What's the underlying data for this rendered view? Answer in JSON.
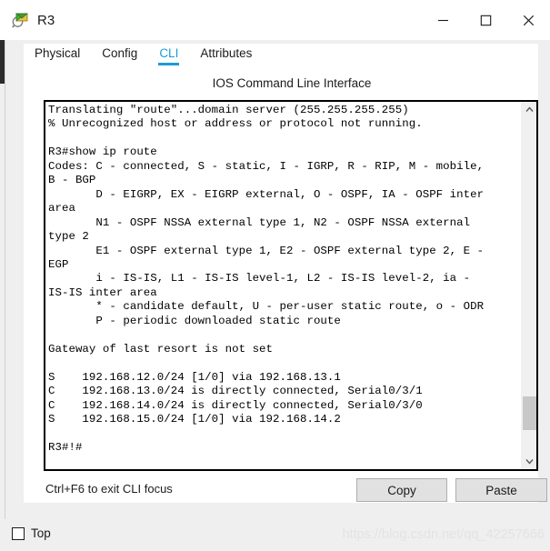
{
  "window": {
    "title": "R3",
    "icon": "packet-tracer-router-icon",
    "controls": {
      "minimize": "minimize-icon",
      "maximize": "maximize-icon",
      "close": "close-icon"
    }
  },
  "tabs": [
    {
      "label": "Physical",
      "active": false
    },
    {
      "label": "Config",
      "active": false
    },
    {
      "label": "CLI",
      "active": true
    },
    {
      "label": "Attributes",
      "active": false
    }
  ],
  "panel": {
    "title": "IOS Command Line Interface"
  },
  "terminal": {
    "lines": [
      "Translating \"route\"...domain server (255.255.255.255)",
      "% Unrecognized host or address or protocol not running.",
      "",
      "R3#show ip route",
      "Codes: C - connected, S - static, I - IGRP, R - RIP, M - mobile,",
      "B - BGP",
      "       D - EIGRP, EX - EIGRP external, O - OSPF, IA - OSPF inter",
      "area",
      "       N1 - OSPF NSSA external type 1, N2 - OSPF NSSA external",
      "type 2",
      "       E1 - OSPF external type 1, E2 - OSPF external type 2, E -",
      "EGP",
      "       i - IS-IS, L1 - IS-IS level-1, L2 - IS-IS level-2, ia -",
      "IS-IS inter area",
      "       * - candidate default, U - per-user static route, o - ODR",
      "       P - periodic downloaded static route",
      "",
      "Gateway of last resort is not set",
      "",
      "S    192.168.12.0/24 [1/0] via 192.168.13.1",
      "C    192.168.13.0/24 is directly connected, Serial0/3/1",
      "C    192.168.14.0/24 is directly connected, Serial0/3/0",
      "S    192.168.15.0/24 [1/0] via 192.168.14.2",
      "",
      "R3#!#"
    ],
    "scrollbar": {
      "up_arrow": "chevron-up-icon",
      "down_arrow": "chevron-down-icon",
      "thumb_top_pct": 83,
      "thumb_height_pct": 10
    }
  },
  "footer": {
    "hint": "Ctrl+F6 to exit CLI focus",
    "copy_label": "Copy",
    "paste_label": "Paste"
  },
  "bottom": {
    "top_checkbox_label": "Top",
    "top_checkbox_checked": false,
    "watermark": "https://blog.csdn.net/qq_42257666"
  },
  "colors": {
    "accent": "#1a9bd7",
    "window_bg": "#efefef",
    "panel_bg": "#ffffff",
    "text": "#1b1b1b",
    "button_face": "#e1e1e1",
    "scrollbar_thumb": "#c8c8c8",
    "watermark": "#e3e3e3"
  }
}
